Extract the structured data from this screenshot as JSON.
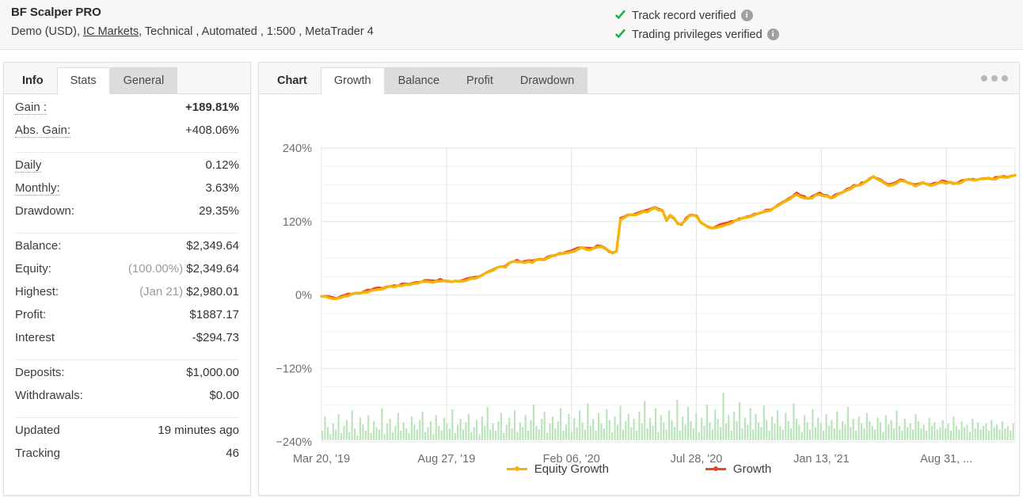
{
  "header": {
    "account_name": "BF Scalper PRO",
    "details_prefix": "Demo (USD),",
    "broker_link": "IC Markets",
    "details_suffix": ", Technical , Automated , 1:500 , MetaTrader 4",
    "verifications": [
      {
        "label": "Track record verified",
        "icon": "check-icon",
        "info": "i"
      },
      {
        "label": "Trading privileges verified",
        "icon": "check-icon",
        "info": "i"
      }
    ]
  },
  "left_panel": {
    "tabs": [
      {
        "label": "Info",
        "state": "first"
      },
      {
        "label": "Stats",
        "state": "active"
      },
      {
        "label": "General",
        "state": "muted"
      }
    ],
    "groups": [
      {
        "rows": [
          {
            "label": "Gain :",
            "dotted": true,
            "value": "+189.81%",
            "value_class": "green bold"
          },
          {
            "label": "Abs. Gain:",
            "dotted": true,
            "value": "+408.06%",
            "value_class": "green"
          }
        ]
      },
      {
        "rows": [
          {
            "label": "Daily",
            "dotted": true,
            "value": "0.12%",
            "value_class": ""
          },
          {
            "label": "Monthly:",
            "dotted": true,
            "value": "3.63%",
            "value_class": ""
          },
          {
            "label": "Drawdown:",
            "dotted": false,
            "value": "29.35%",
            "value_class": ""
          }
        ]
      },
      {
        "rows": [
          {
            "label": "Balance:",
            "dotted": false,
            "value": "$2,349.64",
            "value_class": ""
          },
          {
            "label": "Equity:",
            "dotted": false,
            "prefix": "(100.00%)",
            "value": "$2,349.64",
            "value_class": ""
          },
          {
            "label": "Highest:",
            "dotted": false,
            "prefix": "(Jan 21)",
            "value": "$2,980.01",
            "value_class": ""
          },
          {
            "label": "Profit:",
            "dotted": false,
            "value": "$1887.17",
            "value_class": "green"
          },
          {
            "label": "Interest",
            "dotted": false,
            "value": "-$294.73",
            "value_class": ""
          }
        ]
      },
      {
        "rows": [
          {
            "label": "Deposits:",
            "dotted": false,
            "value": "$1,000.00",
            "value_class": ""
          },
          {
            "label": "Withdrawals:",
            "dotted": false,
            "value": "$0.00",
            "value_class": ""
          }
        ]
      },
      {
        "rows": [
          {
            "label": "Updated",
            "dotted": false,
            "value": "19 minutes ago",
            "value_class": ""
          },
          {
            "label": "Tracking",
            "dotted": false,
            "value": "46",
            "value_class": ""
          }
        ]
      }
    ]
  },
  "right_panel": {
    "tabs": [
      {
        "label": "Chart",
        "state": "first"
      },
      {
        "label": "Growth",
        "state": "active"
      },
      {
        "label": "Balance",
        "state": "muted"
      },
      {
        "label": "Profit",
        "state": "muted"
      },
      {
        "label": "Drawdown",
        "state": "muted"
      }
    ],
    "menu_icon": "more-options-icon"
  },
  "colors": {
    "growth_line": "#e8452c",
    "equity_line": "#f5b40a",
    "volume_bar": "#b9e3b9",
    "verified_check": "#19b04a",
    "positive": "#13b313",
    "grid": "#f0f0f0",
    "grid_major": "#e3e3e3"
  },
  "chart_data": {
    "type": "line",
    "title": "",
    "xlabel": "",
    "ylabel": "",
    "ylim": [
      -240,
      240
    ],
    "ytick_labels": [
      "240%",
      "120%",
      "0%",
      "−120%",
      "−240%"
    ],
    "ytick_values": [
      240,
      120,
      0,
      -120,
      -240
    ],
    "xtick_labels": [
      "Mar 20, '19",
      "Aug 27, '19",
      "Feb 06, '20",
      "Jul 28, '20",
      "Jan 13, '21",
      "Aug 31, ..."
    ],
    "grid": true,
    "legend_position": "bottom",
    "legend": [
      "Equity Growth",
      "Growth"
    ],
    "series": [
      {
        "name": "Equity Growth",
        "color": "#f5b40a",
        "values": [
          -2,
          -3,
          -4,
          -5,
          -4,
          -2,
          0,
          1,
          2,
          3,
          4,
          5,
          7,
          8,
          10,
          11,
          12,
          13,
          14,
          15,
          16,
          17,
          18,
          19,
          20,
          21,
          22,
          23,
          24,
          23,
          24,
          25,
          24,
          23,
          22,
          23,
          24,
          25,
          26,
          27,
          28,
          30,
          33,
          36,
          39,
          42,
          45,
          47,
          46,
          52,
          55,
          56,
          55,
          54,
          57,
          55,
          58,
          60,
          59,
          61,
          63,
          65,
          67,
          69,
          70,
          72,
          74,
          76,
          78,
          77,
          76,
          78,
          80,
          79,
          76,
          72,
          70,
          72,
          125,
          128,
          130,
          131,
          133,
          134,
          136,
          138,
          140,
          142,
          141,
          138,
          122,
          130,
          126,
          118,
          116,
          125,
          130,
          132,
          129,
          120,
          115,
          112,
          110,
          112,
          114,
          116,
          118,
          120,
          122,
          124,
          126,
          128,
          130,
          132,
          134,
          136,
          138,
          140,
          143,
          146,
          150,
          154,
          158,
          162,
          166,
          163,
          160,
          158,
          160,
          163,
          166,
          164,
          162,
          160,
          163,
          166,
          169,
          172,
          175,
          178,
          180,
          183,
          186,
          190,
          194,
          191,
          187,
          183,
          180,
          182,
          185,
          188,
          186,
          184,
          182,
          180,
          182,
          184,
          182,
          180,
          182,
          184,
          186,
          185,
          184,
          183,
          184,
          186,
          188,
          190,
          189,
          188,
          190,
          192,
          191,
          190,
          192,
          194,
          193,
          192,
          194,
          196
        ]
      },
      {
        "name": "Growth",
        "color": "#e8452c",
        "values": [
          -2,
          -3,
          -4,
          -5,
          -4,
          -2,
          0,
          1,
          2,
          3,
          4,
          5,
          7,
          8,
          10,
          11,
          12,
          13,
          14,
          15,
          16,
          17,
          18,
          19,
          20,
          21,
          22,
          23,
          24,
          23,
          24,
          25,
          24,
          23,
          22,
          23,
          24,
          25,
          26,
          27,
          28,
          30,
          33,
          36,
          39,
          42,
          45,
          47,
          46,
          52,
          55,
          56,
          55,
          54,
          57,
          55,
          58,
          60,
          59,
          61,
          63,
          65,
          67,
          69,
          70,
          72,
          74,
          76,
          78,
          77,
          76,
          78,
          80,
          79,
          76,
          72,
          70,
          72,
          125,
          128,
          130,
          131,
          133,
          134,
          136,
          138,
          140,
          142,
          141,
          138,
          122,
          130,
          126,
          118,
          116,
          125,
          130,
          132,
          129,
          120,
          115,
          112,
          110,
          112,
          114,
          116,
          118,
          120,
          122,
          124,
          126,
          128,
          130,
          132,
          134,
          136,
          138,
          140,
          143,
          146,
          150,
          154,
          158,
          162,
          166,
          163,
          160,
          158,
          160,
          163,
          166,
          164,
          162,
          160,
          163,
          166,
          169,
          172,
          175,
          178,
          180,
          183,
          186,
          190,
          194,
          191,
          187,
          183,
          180,
          182,
          185,
          188,
          186,
          184,
          182,
          180,
          182,
          184,
          182,
          180,
          182,
          184,
          186,
          185,
          184,
          183,
          184,
          186,
          188,
          190,
          189,
          188,
          190,
          192,
          191,
          190,
          192,
          194,
          193,
          192,
          194,
          196
        ]
      }
    ],
    "volume": {
      "name": "Volume",
      "color": "#b9e3b9",
      "baseline": -240,
      "max": 44,
      "values": [
        8,
        20,
        11,
        5,
        14,
        9,
        22,
        6,
        12,
        17,
        7,
        25,
        10,
        4,
        19,
        13,
        8,
        21,
        6,
        16,
        11,
        9,
        27,
        5,
        14,
        18,
        7,
        12,
        23,
        8,
        15,
        10,
        6,
        20,
        13,
        9,
        17,
        24,
        7,
        11,
        16,
        5,
        21,
        12,
        8,
        19,
        14,
        10,
        26,
        6,
        13,
        18,
        9,
        15,
        22,
        7,
        11,
        17,
        5,
        20,
        12,
        28,
        9,
        14,
        8,
        16,
        23,
        6,
        13,
        19,
        10,
        25,
        7,
        15,
        11,
        21,
        8,
        17,
        30,
        12,
        9,
        18,
        24,
        6,
        14,
        20,
        10,
        16,
        27,
        8,
        13,
        22,
        7,
        19,
        11,
        25,
        15,
        9,
        31,
        12,
        18,
        8,
        23,
        14,
        10,
        26,
        17,
        7,
        20,
        13,
        29,
        9,
        16,
        22,
        11,
        18,
        8,
        24,
        14,
        33,
        10,
        19,
        12,
        27,
        7,
        21,
        15,
        9,
        25,
        17,
        11,
        34,
        8,
        20,
        13,
        28,
        16,
        10,
        23,
        7,
        19,
        12,
        30,
        15,
        9,
        26,
        18,
        11,
        40,
        14,
        21,
        8,
        24,
        16,
        32,
        10,
        19,
        13,
        27,
        9,
        22,
        15,
        11,
        29,
        17,
        8,
        20,
        14,
        25,
        12,
        9,
        23,
        16,
        10,
        31,
        18,
        13,
        7,
        21,
        15,
        9,
        26,
        11,
        19,
        14,
        8,
        22,
        12,
        17,
        10,
        24,
        9,
        16,
        13,
        28,
        11,
        18,
        8,
        20,
        14,
        10,
        23,
        16,
        12,
        9,
        19,
        15,
        7,
        21,
        13,
        17,
        10,
        25,
        12,
        8,
        18,
        11,
        14,
        9,
        22,
        16,
        10,
        13,
        8,
        19,
        12,
        15,
        9,
        11,
        17,
        10,
        14,
        8,
        20,
        12,
        9,
        16,
        11,
        13,
        7,
        18,
        10,
        15,
        9,
        12,
        14,
        8,
        17,
        11,
        13,
        9,
        16,
        10,
        12,
        8,
        14
      ]
    }
  }
}
